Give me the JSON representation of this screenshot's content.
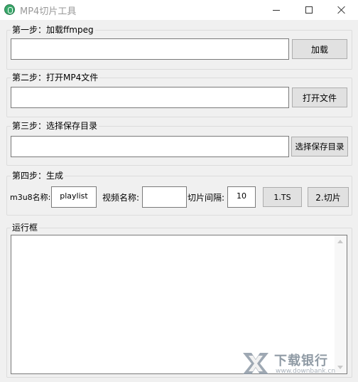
{
  "window": {
    "title": "MP4切片工具",
    "minimize_icon": "minimize-icon",
    "maximize_icon": "maximize-icon",
    "close_icon": "close-icon"
  },
  "step1": {
    "legend": "第一步：加载ffmpeg",
    "path_value": "",
    "button_label": "加载"
  },
  "step2": {
    "legend": "第二步：打开MP4文件",
    "path_value": "",
    "button_label": "打开文件"
  },
  "step3": {
    "legend": "第三步：选择保存目录",
    "path_value": "",
    "button_label": "选择保存目录"
  },
  "step4": {
    "legend": "第四步：生成",
    "m3u8_label": "m3u8名称:",
    "m3u8_value": "playlist",
    "video_name_label": "视频名称:",
    "video_name_value": "",
    "interval_label": "切片间隔:",
    "interval_value": "10",
    "ts_button_label": "1.TS",
    "slice_button_label": "2.切片"
  },
  "log": {
    "legend": "运行框",
    "content": ""
  },
  "watermark": {
    "text": "下载银行",
    "url": "www.downbank.cn"
  },
  "colors": {
    "window_bg": "#f0f0f0",
    "title_text": "#999999",
    "button_bg": "#e1e1e1",
    "button_border": "#adadad",
    "input_border": "#7a7a7a",
    "group_border": "#dcdcdc",
    "app_icon": "#3aa86b"
  }
}
